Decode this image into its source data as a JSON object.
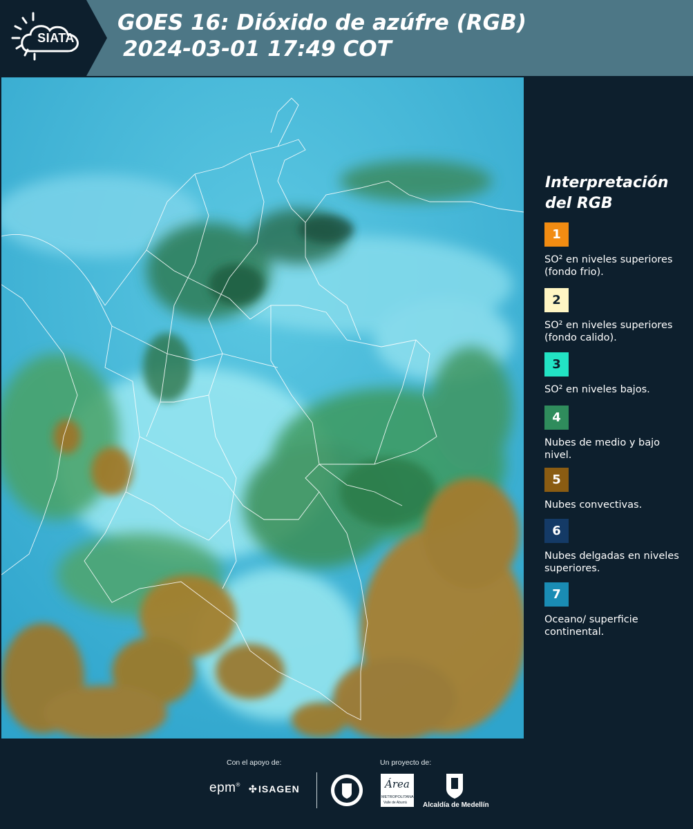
{
  "header": {
    "logo_text": "SIATA",
    "title_line1": "GOES 16: Dióxido de azúfre (RGB)",
    "title_line2": "2024-03-01 17:49 COT"
  },
  "legend": {
    "title_line1": "Interpretación",
    "title_line2": "del RGB",
    "items": [
      {
        "number": "1",
        "color": "#f28c12",
        "text_color": "#ffffff",
        "text": "SO² en niveles superiores (fondo frio)."
      },
      {
        "number": "2",
        "color": "#fff6c4",
        "text_color": "#0d1f2d",
        "text": "SO² en niveles superiores (fondo calido)."
      },
      {
        "number": "3",
        "color": "#22e3c4",
        "text_color": "#0d1f2d",
        "text": "SO² en niveles bajos."
      },
      {
        "number": "4",
        "color": "#2f8c5c",
        "text_color": "#ffffff",
        "text": "Nubes de medio y bajo nivel."
      },
      {
        "number": "5",
        "color": "#8a5c12",
        "text_color": "#ffffff",
        "text": "Nubes convectivas."
      },
      {
        "number": "6",
        "color": "#143a66",
        "text_color": "#ffffff",
        "text": "Nubes delgadas en niveles superiores."
      },
      {
        "number": "7",
        "color": "#1a8cb4",
        "text_color": "#ffffff",
        "text": "Oceano/ superficie continental."
      }
    ]
  },
  "footer": {
    "support_label": "Con el apoyo de:",
    "project_label": "Un proyecto de:",
    "epm": "epm",
    "isagen": "ISAGEN",
    "area_name": "Área",
    "area_sub1": "METROPOLITANA",
    "area_sub2": "Valle de Aburrá",
    "alcaldia": "Alcaldía de Medellín"
  },
  "colors": {
    "header_bg": "#4d7786",
    "logo_bg": "#0d1f2d",
    "page_bg": "#0d1f2d",
    "ocean": "#39b4d6",
    "cloud_light": "#8ee4f0",
    "vegetation": "#3d8c5a",
    "convective": "#a8802e"
  }
}
